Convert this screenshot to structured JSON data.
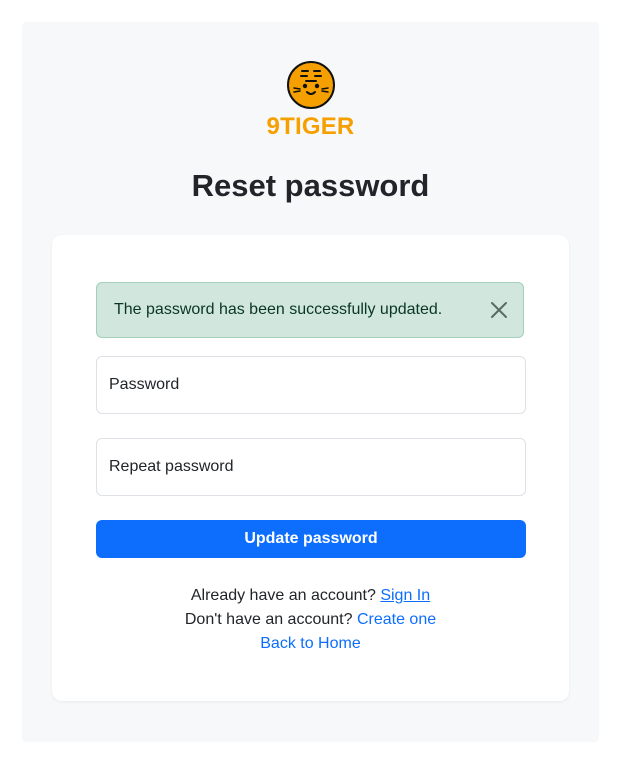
{
  "brand": {
    "name": "9TIGER",
    "logo_icon": "tiger-face-icon",
    "color": "#f5a000"
  },
  "page": {
    "title": "Reset password"
  },
  "alert": {
    "message": "The password has been successfully updated.",
    "close_icon": "close-icon",
    "background": "#d1e7dd"
  },
  "form": {
    "password_placeholder": "Password",
    "repeat_password_placeholder": "Repeat password",
    "submit_label": "Update password",
    "accent": "#0d6efd"
  },
  "footer_links": {
    "signin_prompt": "Already have an account?",
    "signin_link": "Sign In",
    "signup_prompt": "Don't have an account?",
    "signup_link": "Create one",
    "home_link": "Back to Home"
  }
}
